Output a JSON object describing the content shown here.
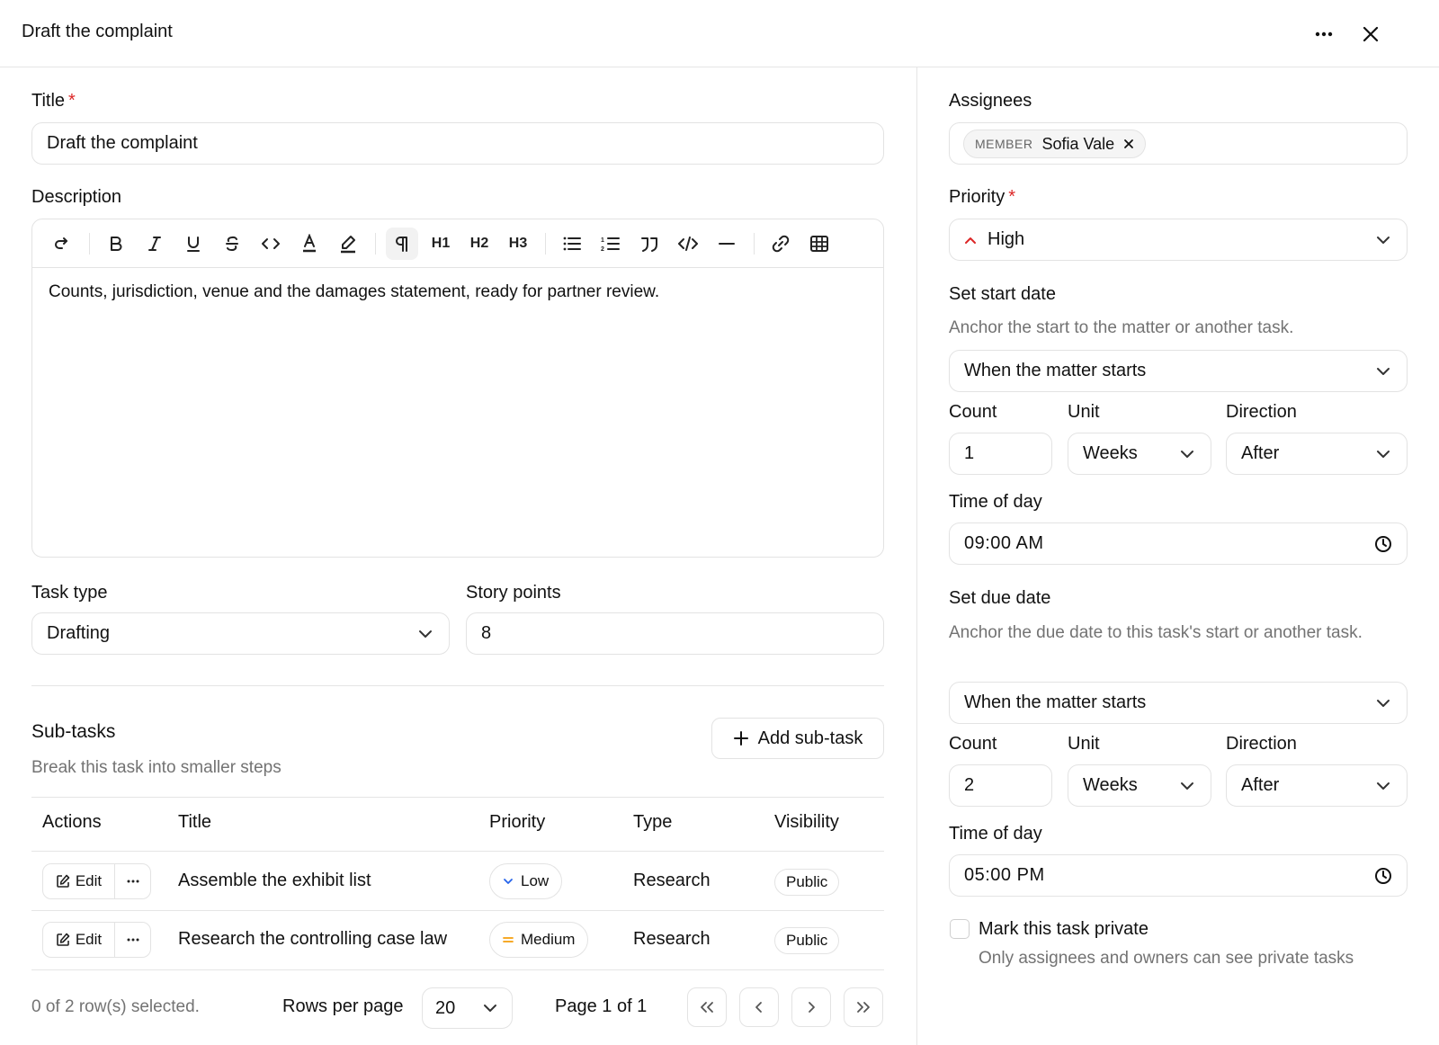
{
  "dialog": {
    "title": "Draft the complaint",
    "more_icon": "more-horizontal-icon",
    "close_icon": "close-icon"
  },
  "form": {
    "title_label": "Title",
    "title_required": "*",
    "title_value": "Draft the complaint",
    "description_label": "Description",
    "description_text": "Counts, jurisdiction, venue and the damages statement, ready for partner review.",
    "toolbar": {
      "h1": "H1",
      "h2": "H2",
      "h3": "H3"
    },
    "task_type_label": "Task type",
    "task_type_value": "Drafting",
    "story_points_label": "Story points",
    "story_points_value": "8"
  },
  "subtasks": {
    "heading": "Sub-tasks",
    "subtitle": "Break this task into smaller steps",
    "add_button": "Add sub-task",
    "columns": {
      "actions": "Actions",
      "title": "Title",
      "priority": "Priority",
      "type": "Type",
      "visibility": "Visibility"
    },
    "rows": [
      {
        "edit": "Edit",
        "title": "Assemble the exhibit list",
        "priority": "Low",
        "type": "Research",
        "visibility": "Public"
      },
      {
        "edit": "Edit",
        "title": "Research the controlling case law",
        "priority": "Medium",
        "type": "Research",
        "visibility": "Public"
      }
    ],
    "selection_status": "0 of 2 row(s) selected.",
    "rows_per_page_label": "Rows per page",
    "rows_per_page_value": "20",
    "page_status": "Page 1 of 1"
  },
  "side": {
    "assignees_label": "Assignees",
    "assignee": {
      "type": "MEMBER",
      "name": "Sofia Vale"
    },
    "priority_label": "Priority",
    "priority_required": "*",
    "priority_value": "High",
    "start": {
      "heading": "Set start date",
      "help": "Anchor the start to the matter or another task.",
      "anchor": "When the matter starts",
      "count_label": "Count",
      "count_value": "1",
      "unit_label": "Unit",
      "unit_value": "Weeks",
      "direction_label": "Direction",
      "direction_value": "After",
      "time_label": "Time of day",
      "time_value": "09:00 AM"
    },
    "due": {
      "heading": "Set due date",
      "help": "Anchor the due date to this task's start or another task.",
      "anchor": "When the matter starts",
      "count_label": "Count",
      "count_value": "2",
      "unit_label": "Unit",
      "unit_value": "Weeks",
      "direction_label": "Direction",
      "direction_value": "After",
      "time_label": "Time of day",
      "time_value": "05:00 PM"
    },
    "private_label": "Mark this task private",
    "private_help": "Only assignees and owners can see private tasks",
    "private_checked": false
  },
  "colors": {
    "required": "#dc2626",
    "priority_high": "#dc2626",
    "priority_low": "#2563eb",
    "priority_medium": "#f59e0b",
    "border": "#e3e3e3",
    "muted_text": "#737373"
  }
}
